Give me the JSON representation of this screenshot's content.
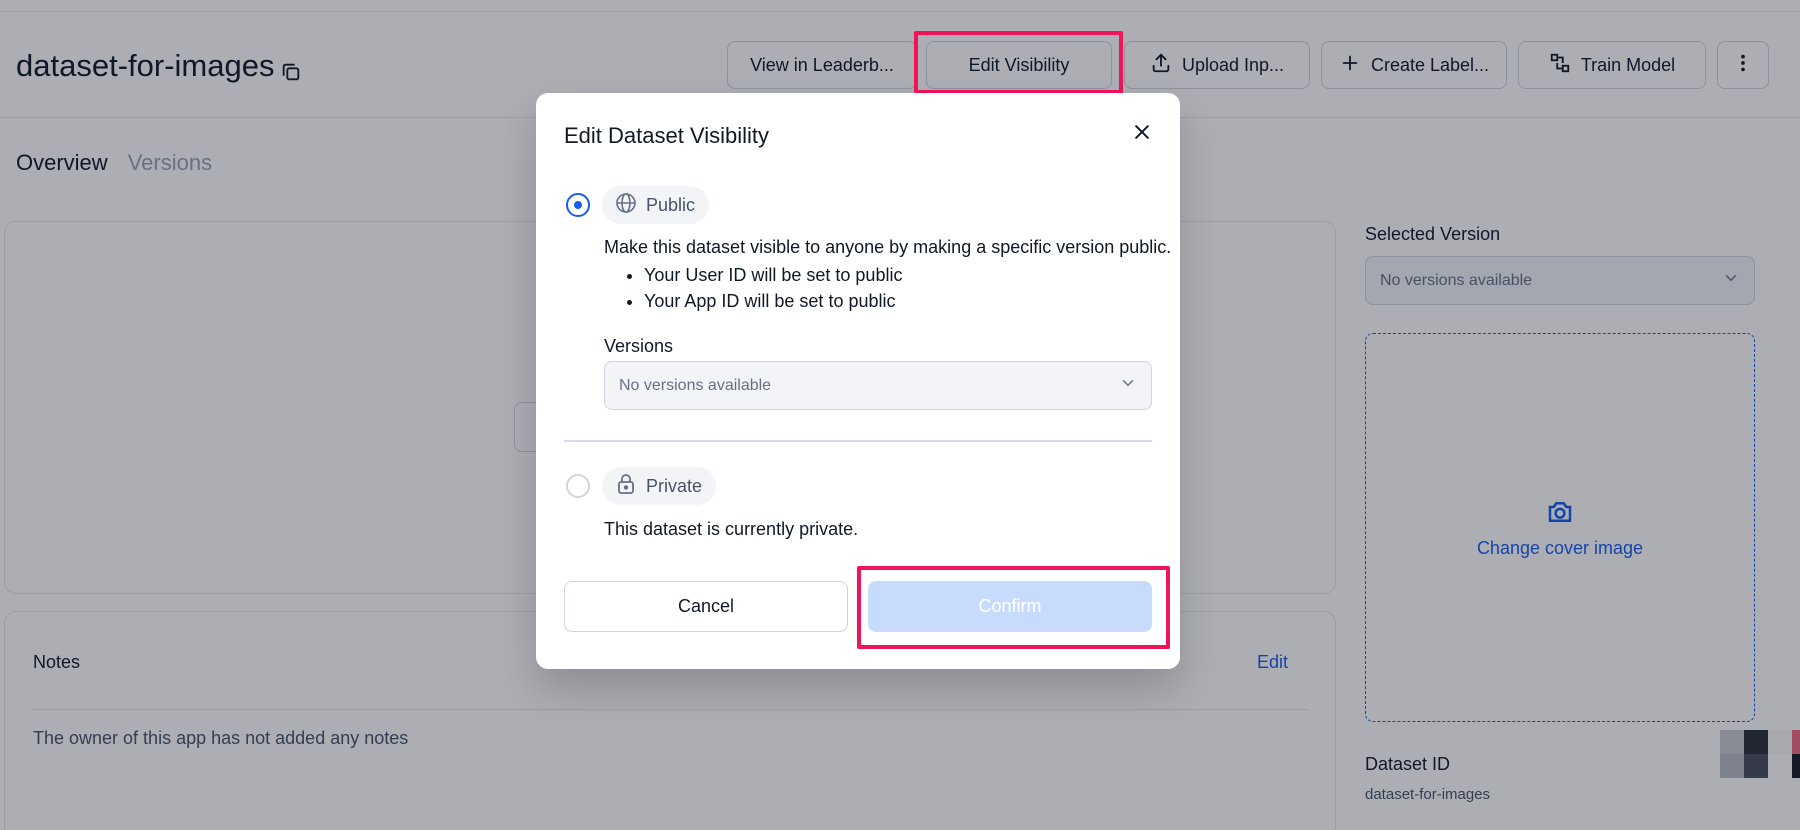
{
  "page": {
    "title": "dataset-for-images",
    "header_buttons": {
      "leaderboard": "View in Leaderb...",
      "edit_visibility": "Edit Visibility",
      "upload_inputs": "Upload Inp...",
      "create_labels": "Create Label...",
      "train_model": "Train Model"
    },
    "tabs": [
      "Overview",
      "Versions"
    ],
    "notes": {
      "title": "Notes",
      "edit_label": "Edit",
      "empty_text": "The owner of this app has not added any notes"
    },
    "sidebar": {
      "selected_version_label": "Selected Version",
      "selected_version_value": "No versions available",
      "cover_image_label": "Change cover image",
      "dataset_id_label": "Dataset ID",
      "dataset_id_value": "dataset-for-images"
    }
  },
  "modal": {
    "title": "Edit Dataset Visibility",
    "public": {
      "label": "Public",
      "selected": true,
      "description": "Make this dataset visible to anyone by making a specific version public.",
      "bullets": [
        "Your User ID will be set to public",
        "Your App ID will be set to public"
      ],
      "versions_label": "Versions",
      "versions_value": "No versions available"
    },
    "private": {
      "label": "Private",
      "selected": false,
      "description": "This dataset is currently private."
    },
    "cancel_label": "Cancel",
    "confirm_label": "Confirm"
  },
  "colors": {
    "accent": "#155eef",
    "highlight": "#f0145a",
    "confirm_disabled": "#c7dcfc"
  },
  "icons": {
    "title_copy": "copy-icon",
    "upload": "upload-icon",
    "create": "plus-icon",
    "train": "model-icon",
    "more": "more-vertical-icon",
    "close": "close-icon",
    "public": "globe-icon",
    "private": "lock-icon",
    "dropdown": "chevron-down-icon",
    "cover": "camera-icon"
  }
}
